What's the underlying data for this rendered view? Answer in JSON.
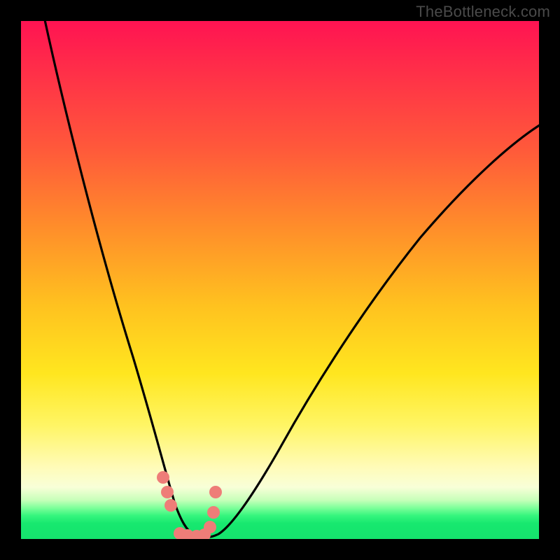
{
  "watermark": "TheBottleneck.com",
  "colors": {
    "frame": "#000000",
    "curve": "#000000",
    "marker": "#ee7d78",
    "gradient_stops": [
      "#ff1352",
      "#ff5a3a",
      "#ffc21f",
      "#fff564",
      "#c7ffb9",
      "#17e86f"
    ]
  },
  "chart_data": {
    "type": "line",
    "title": "",
    "xlabel": "",
    "ylabel": "",
    "xlim": [
      0,
      100
    ],
    "ylim": [
      0,
      100
    ],
    "grid": false,
    "legend": false,
    "annotation": "V-shaped bottleneck curve; valley near x≈33 at y≈0. Background is a vertical red→green gradient (red = high bottleneck, green = low). Pink dots mark the near-optimal region around the valley.",
    "series": [
      {
        "name": "bottleneck-curve",
        "x": [
          4,
          8,
          12,
          16,
          20,
          24,
          27,
          29,
          31,
          33,
          35,
          38,
          42,
          48,
          56,
          66,
          78,
          90,
          100
        ],
        "y": [
          100,
          80,
          62,
          46,
          32,
          20,
          12,
          6,
          2,
          0,
          1,
          4,
          10,
          20,
          33,
          48,
          62,
          72,
          78
        ]
      }
    ],
    "markers": {
      "name": "optimal-range-dots",
      "x": [
        27.2,
        28.0,
        28.7,
        30.5,
        32.0,
        33.8,
        35.3,
        36.3,
        37.0,
        37.3
      ],
      "y": [
        12.0,
        9.0,
        6.5,
        0.8,
        0.6,
        0.6,
        0.8,
        2.5,
        5.5,
        9.5
      ]
    }
  }
}
